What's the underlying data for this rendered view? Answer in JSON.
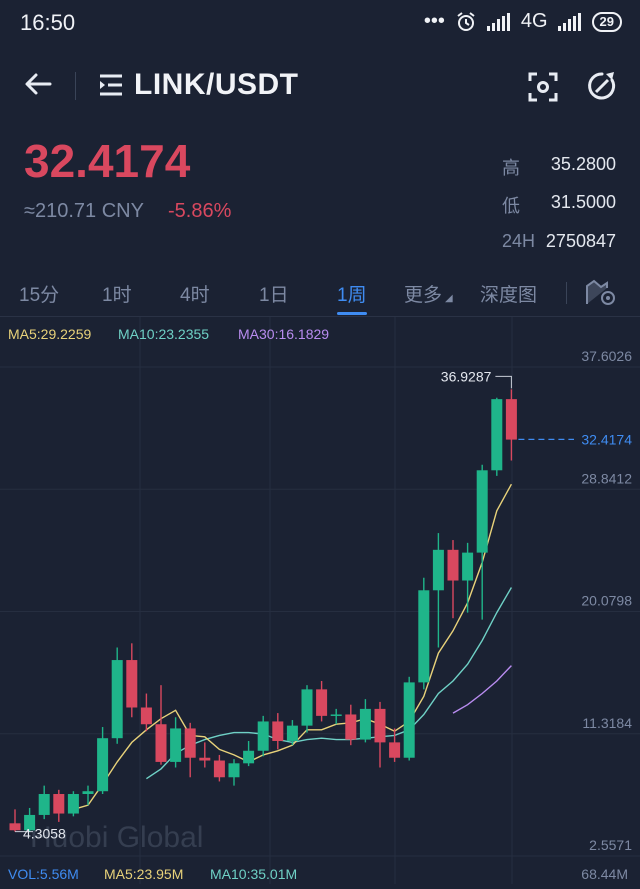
{
  "status_bar": {
    "time": "16:50",
    "dots": "•••",
    "network": "4G",
    "battery": "29"
  },
  "header": {
    "pair": "LINK/USDT"
  },
  "ticker": {
    "price": "32.4174",
    "cny": "≈210.71 CNY",
    "change": "-5.86%",
    "high_label": "高",
    "high": "35.2800",
    "low_label": "低",
    "low": "31.5000",
    "vol_label": "24H",
    "vol": "2750847"
  },
  "tabs": [
    {
      "label": "15分"
    },
    {
      "label": "1时"
    },
    {
      "label": "4时"
    },
    {
      "label": "1日"
    },
    {
      "label": "1周"
    },
    {
      "label": "更多"
    },
    {
      "label": "深度图"
    }
  ],
  "legend": {
    "ma5": "MA5:29.2259",
    "ma10": "MA10:23.2355",
    "ma30": "MA30:16.1829"
  },
  "volume_legend": {
    "vol": "VOL:5.56M",
    "ma5": "MA5:23.95M",
    "ma10": "MA10:35.01M",
    "right": "68.44M"
  },
  "watermark": "Huobi Global",
  "colors": {
    "up": "#1fb58a",
    "down": "#d9485f",
    "accent": "#3f8cf2",
    "ma5": "#e8d27a",
    "ma10": "#6fd1c6",
    "ma30": "#b98cf0"
  },
  "chart_data": {
    "type": "candlestick",
    "interval": "1周",
    "y_ticks": [
      "37.6026",
      "28.8412",
      "20.0798",
      "11.3184",
      "2.5571"
    ],
    "y_ticks_values": [
      37.6026,
      28.8412,
      20.0798,
      11.3184,
      2.5571
    ],
    "ylim": [
      2.5571,
      37.6026
    ],
    "last_price_label": "32.4174",
    "last_price": 32.4174,
    "max_label": "36.9287",
    "max_value": 36.9287,
    "min_label": "4.3058",
    "min_value": 4.3058,
    "candles": [
      [
        4.9,
        4.4,
        5.9,
        4.3
      ],
      [
        4.4,
        5.5,
        6.0,
        4.3
      ],
      [
        5.5,
        7.0,
        7.6,
        5.2
      ],
      [
        7.0,
        5.6,
        7.3,
        5.0
      ],
      [
        5.6,
        7.0,
        7.2,
        5.4
      ],
      [
        7.0,
        7.2,
        7.6,
        6.2
      ],
      [
        7.2,
        11.0,
        11.8,
        7.0
      ],
      [
        11.0,
        16.6,
        17.5,
        10.6
      ],
      [
        16.6,
        13.2,
        17.8,
        12.5
      ],
      [
        13.2,
        12.0,
        14.2,
        11.5
      ],
      [
        12.0,
        9.3,
        14.8,
        9.1
      ],
      [
        9.3,
        11.7,
        12.5,
        8.9
      ],
      [
        11.7,
        9.6,
        12.1,
        8.2
      ],
      [
        9.6,
        9.4,
        10.7,
        8.9
      ],
      [
        9.4,
        8.2,
        9.8,
        7.9
      ],
      [
        8.2,
        9.2,
        9.5,
        7.6
      ],
      [
        9.2,
        10.1,
        10.8,
        9.0
      ],
      [
        10.1,
        12.2,
        12.6,
        9.7
      ],
      [
        12.2,
        10.8,
        12.8,
        10.2
      ],
      [
        10.8,
        11.9,
        12.3,
        10.5
      ],
      [
        11.9,
        14.5,
        14.8,
        11.4
      ],
      [
        14.5,
        12.6,
        15.1,
        12.2
      ],
      [
        12.6,
        12.7,
        13.1,
        12.0
      ],
      [
        12.7,
        10.9,
        13.4,
        10.5
      ],
      [
        10.9,
        13.1,
        13.8,
        10.7
      ],
      [
        13.1,
        10.7,
        13.6,
        8.9
      ],
      [
        10.7,
        9.6,
        11.7,
        9.3
      ],
      [
        9.6,
        15.0,
        15.4,
        9.4
      ],
      [
        15.0,
        21.6,
        22.5,
        14.5
      ],
      [
        21.6,
        24.5,
        25.7,
        17.5
      ],
      [
        24.5,
        22.3,
        25.2,
        19.6
      ],
      [
        22.3,
        24.3,
        25.0,
        20.0
      ],
      [
        24.3,
        30.2,
        30.6,
        19.5
      ],
      [
        30.2,
        35.3,
        35.4,
        29.8
      ],
      [
        35.3,
        32.4,
        36.0,
        30.9
      ]
    ],
    "ma5": [
      null,
      null,
      null,
      null,
      5.9,
      6.2,
      7.7,
      9.3,
      10.7,
      11.6,
      12.4,
      13.0,
      11.2,
      11.1,
      10.2,
      9.8,
      9.3,
      9.8,
      10.1,
      10.5,
      11.6,
      11.6,
      12.0,
      12.1,
      12.4,
      12.0,
      11.5,
      12.2,
      14.0,
      17.1,
      18.7,
      20.7,
      23.6,
      27.3,
      29.2
    ],
    "ma10": [
      null,
      null,
      null,
      null,
      null,
      null,
      null,
      null,
      null,
      8.1,
      8.8,
      9.9,
      10.5,
      10.9,
      11.2,
      11.4,
      11.4,
      11.3,
      10.9,
      10.7,
      10.9,
      11.0,
      10.9,
      10.9,
      11.0,
      11.1,
      11.2,
      11.6,
      12.7,
      14.2,
      15.1,
      16.3,
      18.0,
      20.0,
      21.8
    ],
    "ma30": [
      null,
      null,
      null,
      null,
      null,
      null,
      null,
      null,
      null,
      null,
      null,
      null,
      null,
      null,
      null,
      null,
      null,
      null,
      null,
      null,
      null,
      null,
      null,
      null,
      null,
      null,
      null,
      null,
      null,
      null,
      12.8,
      13.4,
      14.2,
      15.1,
      16.2
    ]
  }
}
